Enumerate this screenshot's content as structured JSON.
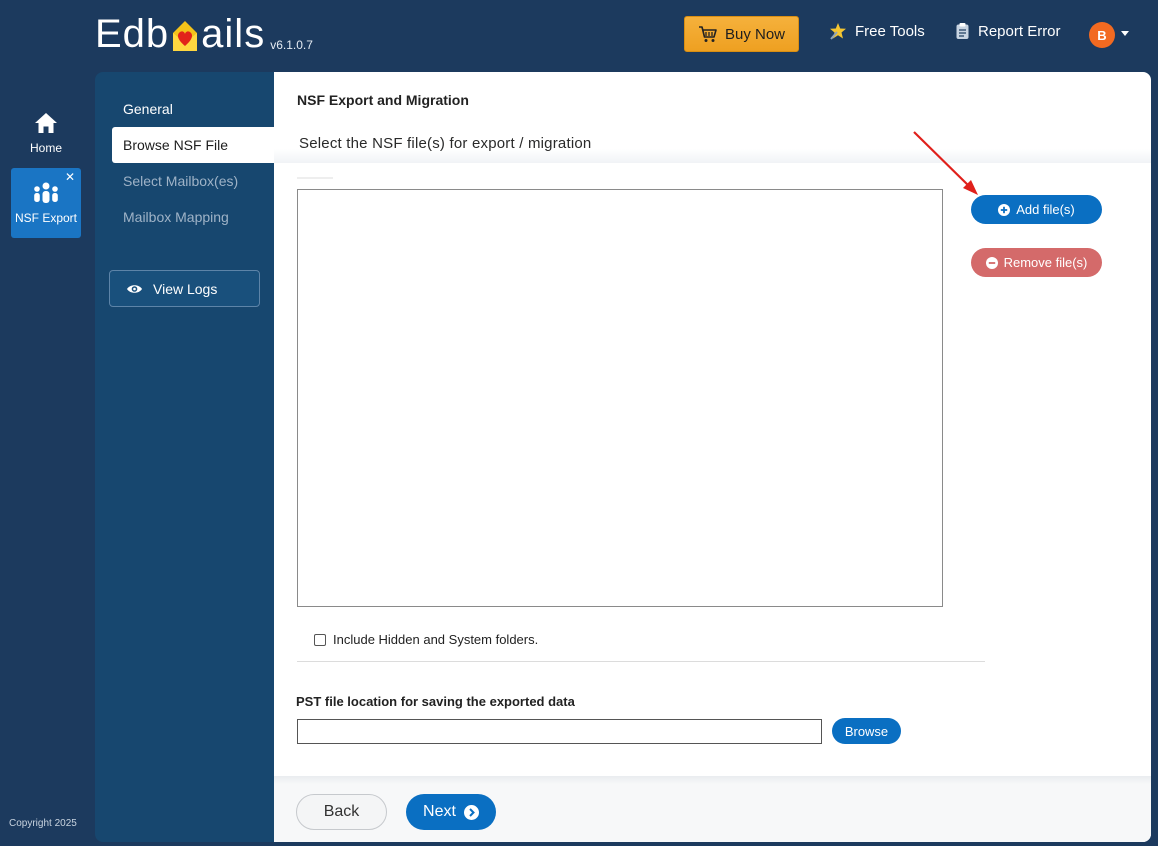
{
  "app": {
    "name_left": "Edb",
    "name_right": "ails",
    "version": "v6.1.0.7"
  },
  "topbar": {
    "buy_now": "Buy Now",
    "free_tools": "Free Tools",
    "report_error": "Report Error",
    "avatar_initial": "B"
  },
  "rail": {
    "home_label": "Home",
    "nsf_label": "NSF Export",
    "close_glyph": "✕"
  },
  "steps": [
    {
      "label": "General",
      "state": "done"
    },
    {
      "label": "Browse NSF File",
      "state": "active"
    },
    {
      "label": "Select Mailbox(es)",
      "state": "pending"
    },
    {
      "label": "Mailbox Mapping",
      "state": "pending"
    }
  ],
  "view_logs": "View Logs",
  "main": {
    "title": "NSF Export and Migration",
    "section_title": "Select the NSF file(s) for export / migration",
    "add_files": "Add file(s)",
    "remove_files": "Remove file(s)",
    "include_hidden": "Include Hidden and System folders.",
    "include_hidden_checked": false,
    "pst_label": "PST file location for saving the exported data",
    "pst_value": "",
    "browse": "Browse"
  },
  "footer": {
    "back": "Back",
    "next": "Next"
  },
  "copyright": "Copyright 2025",
  "colors": {
    "background": "#1c3a5e",
    "sidepanel": "#17476f",
    "accent_blue": "#0a6fc2",
    "remove_red": "#d46a6a",
    "buy_orange": "#f0a52a",
    "avatar_orange": "#f26a21",
    "annotation_arrow": "#e0201b"
  },
  "icons": {
    "logo": "envelope-heart-icon",
    "buy_now": "cart-icon",
    "free_tools": "star-tools-icon",
    "report_error": "clipboard-icon",
    "home": "home-icon",
    "nsf_export": "users-icon",
    "view_logs": "eye-icon",
    "add_files": "plus-circle-icon",
    "remove_files": "minus-circle-icon",
    "next": "chevron-right-circle-icon"
  }
}
